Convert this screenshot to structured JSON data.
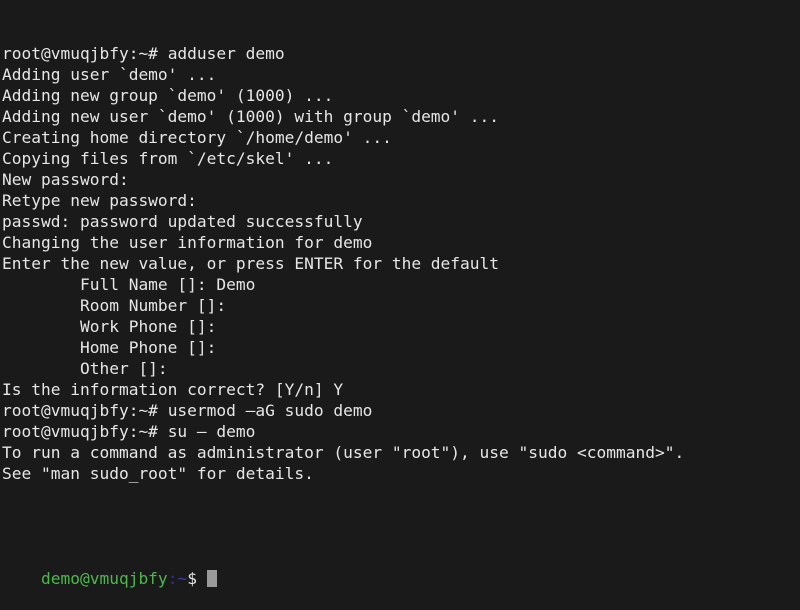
{
  "terminal": {
    "background_color": "#1a1a1a",
    "foreground_color": "#e6e6e6",
    "prompt_user_color": "#4eb84e",
    "prompt_path_color": "#3a3aa8",
    "cursor_color": "#9a9a9a",
    "hostname": "vmuqjbfy",
    "lines": [
      {
        "id": "l01",
        "type": "prompt-root",
        "prompt": "root@vmuqjbfy:~# ",
        "command": "adduser demo"
      },
      {
        "id": "l02",
        "type": "output",
        "text": "Adding user `demo' ..."
      },
      {
        "id": "l03",
        "type": "output",
        "text": "Adding new group `demo' (1000) ..."
      },
      {
        "id": "l04",
        "type": "output",
        "text": "Adding new user `demo' (1000) with group `demo' ..."
      },
      {
        "id": "l05",
        "type": "output",
        "text": "Creating home directory `/home/demo' ..."
      },
      {
        "id": "l06",
        "type": "output",
        "text": "Copying files from `/etc/skel' ..."
      },
      {
        "id": "l07",
        "type": "output",
        "text": "New password:"
      },
      {
        "id": "l08",
        "type": "output",
        "text": "Retype new password:"
      },
      {
        "id": "l09",
        "type": "output",
        "text": "passwd: password updated successfully"
      },
      {
        "id": "l10",
        "type": "output",
        "text": "Changing the user information for demo"
      },
      {
        "id": "l11",
        "type": "output",
        "text": "Enter the new value, or press ENTER for the default"
      },
      {
        "id": "l12",
        "type": "output",
        "text": "        Full Name []: Demo"
      },
      {
        "id": "l13",
        "type": "output",
        "text": "        Room Number []:"
      },
      {
        "id": "l14",
        "type": "output",
        "text": "        Work Phone []:"
      },
      {
        "id": "l15",
        "type": "output",
        "text": "        Home Phone []:"
      },
      {
        "id": "l16",
        "type": "output",
        "text": "        Other []:"
      },
      {
        "id": "l17",
        "type": "output",
        "text": "Is the information correct? [Y/n] Y"
      },
      {
        "id": "l18",
        "type": "prompt-root",
        "prompt": "root@vmuqjbfy:~# ",
        "command": "usermod –aG sudo demo"
      },
      {
        "id": "l19",
        "type": "prompt-root",
        "prompt": "root@vmuqjbfy:~# ",
        "command": "su – demo"
      },
      {
        "id": "l20",
        "type": "output",
        "text": "To run a command as administrator (user \"root\"), use \"sudo <command>\"."
      },
      {
        "id": "l21",
        "type": "output",
        "text": "See \"man sudo_root\" for details."
      },
      {
        "id": "l22",
        "type": "blank",
        "text": ""
      }
    ],
    "active_prompt": {
      "user_host": "demo@vmuqjbfy",
      "separator": ":",
      "path": "~",
      "symbol": "$",
      "input": ""
    }
  }
}
